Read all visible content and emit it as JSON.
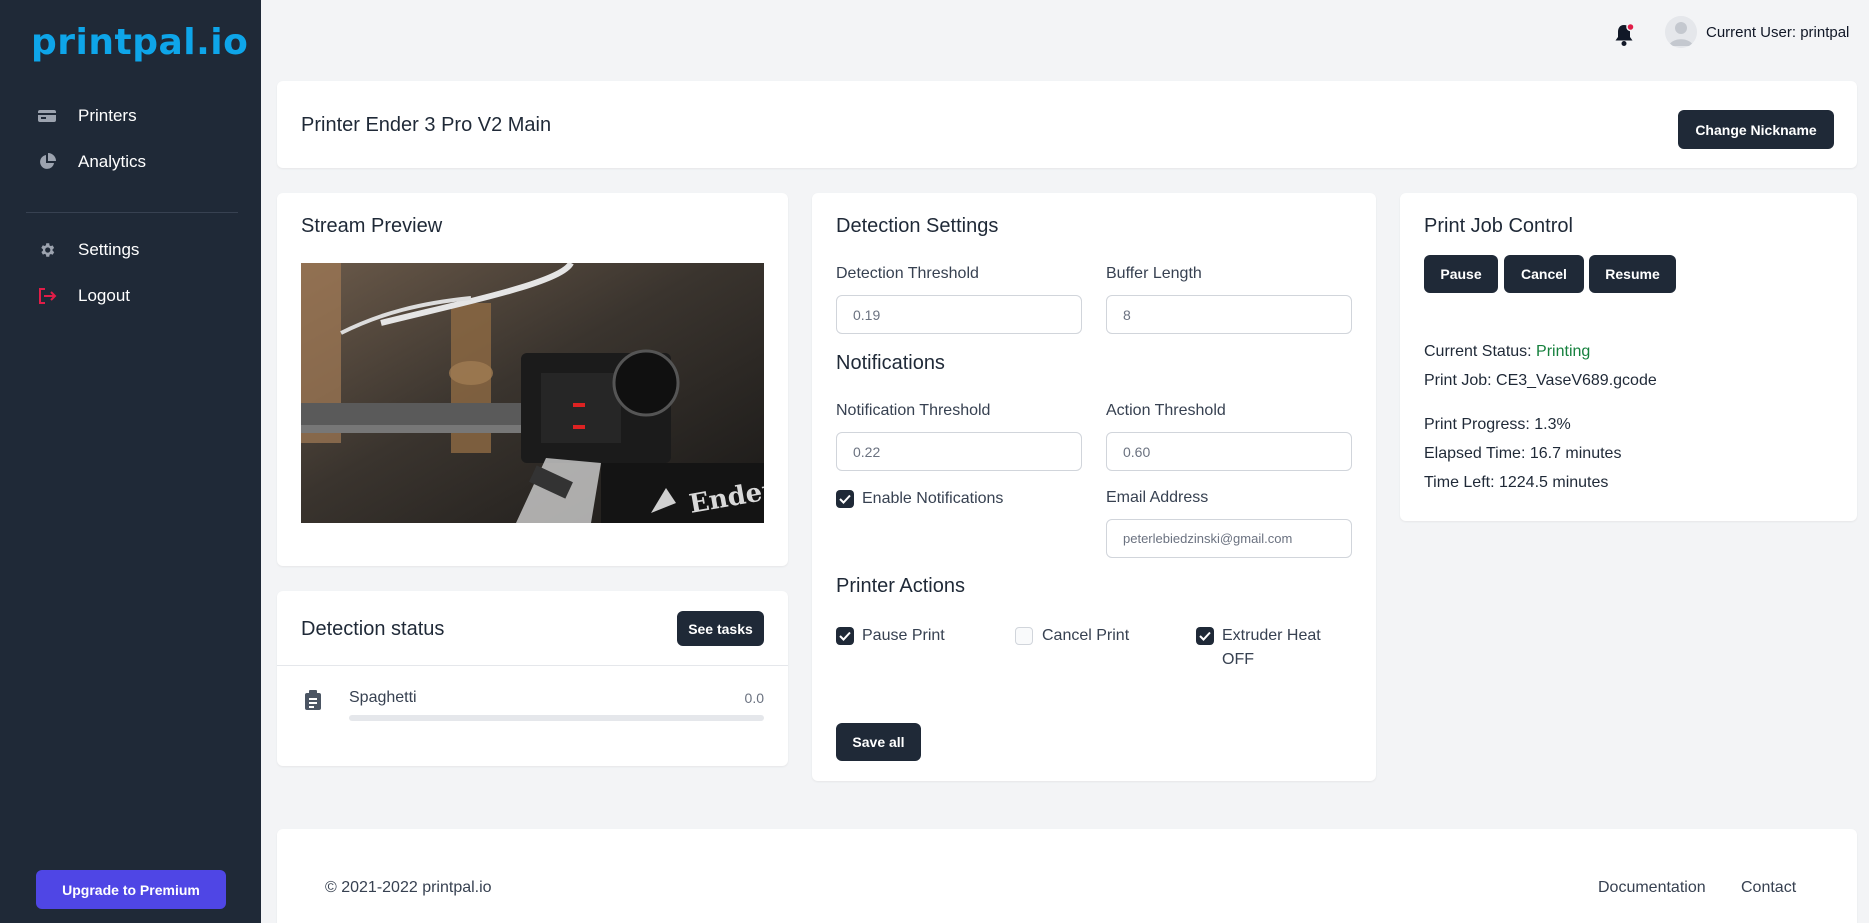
{
  "app": {
    "logo": "printpal.io",
    "accent": "#0ea5e9"
  },
  "sidebar": {
    "items": [
      {
        "label": "Printers",
        "icon": "printer-icon"
      },
      {
        "label": "Analytics",
        "icon": "pie-chart-icon"
      },
      {
        "label": "Settings",
        "icon": "gear-icon"
      },
      {
        "label": "Logout",
        "icon": "logout-icon"
      }
    ],
    "upgrade_label": "Upgrade to Premium"
  },
  "header": {
    "user_label": "Current User: printpal"
  },
  "printer": {
    "title": "Printer Ender 3 Pro V2 Main",
    "change_nickname_label": "Change Nickname"
  },
  "stream": {
    "title": "Stream Preview"
  },
  "detection_status": {
    "title": "Detection status",
    "see_tasks_label": "See tasks",
    "items": [
      {
        "label": "Spaghetti",
        "value": "0.0",
        "progress": 0.0
      }
    ]
  },
  "detection_settings": {
    "title": "Detection Settings",
    "detection_threshold": {
      "label": "Detection Threshold",
      "placeholder": "0.19"
    },
    "buffer_length": {
      "label": "Buffer Length",
      "placeholder": "8"
    },
    "notifications_title": "Notifications",
    "notification_threshold": {
      "label": "Notification Threshold",
      "placeholder": "0.22"
    },
    "action_threshold": {
      "label": "Action Threshold",
      "placeholder": "0.60"
    },
    "enable_notifications": {
      "label": "Enable Notifications",
      "checked": true
    },
    "email": {
      "label": "Email Address",
      "placeholder": "peterlebiedzinski@gmail.com"
    },
    "printer_actions_title": "Printer Actions",
    "actions": [
      {
        "label": "Pause Print",
        "checked": true
      },
      {
        "label": "Cancel Print",
        "checked": false
      },
      {
        "label_line1": "Extruder Heat",
        "label_line2": "OFF",
        "checked": true
      }
    ],
    "save_label": "Save all"
  },
  "print_job": {
    "title": "Print Job Control",
    "pause_label": "Pause",
    "cancel_label": "Cancel",
    "resume_label": "Resume",
    "status_prefix": "Current Status: ",
    "status_value": "Printing",
    "status_color": "#15803d",
    "job_line": "Print Job: CE3_VaseV689.gcode",
    "progress_line": "Print Progress: 1.3%",
    "elapsed_line": "Elapsed Time: 16.7 minutes",
    "left_line": "Time Left: 1224.5 minutes"
  },
  "footer": {
    "copyright": "© 2021-2022 printpal.io",
    "documentation": "Documentation",
    "contact": "Contact"
  }
}
